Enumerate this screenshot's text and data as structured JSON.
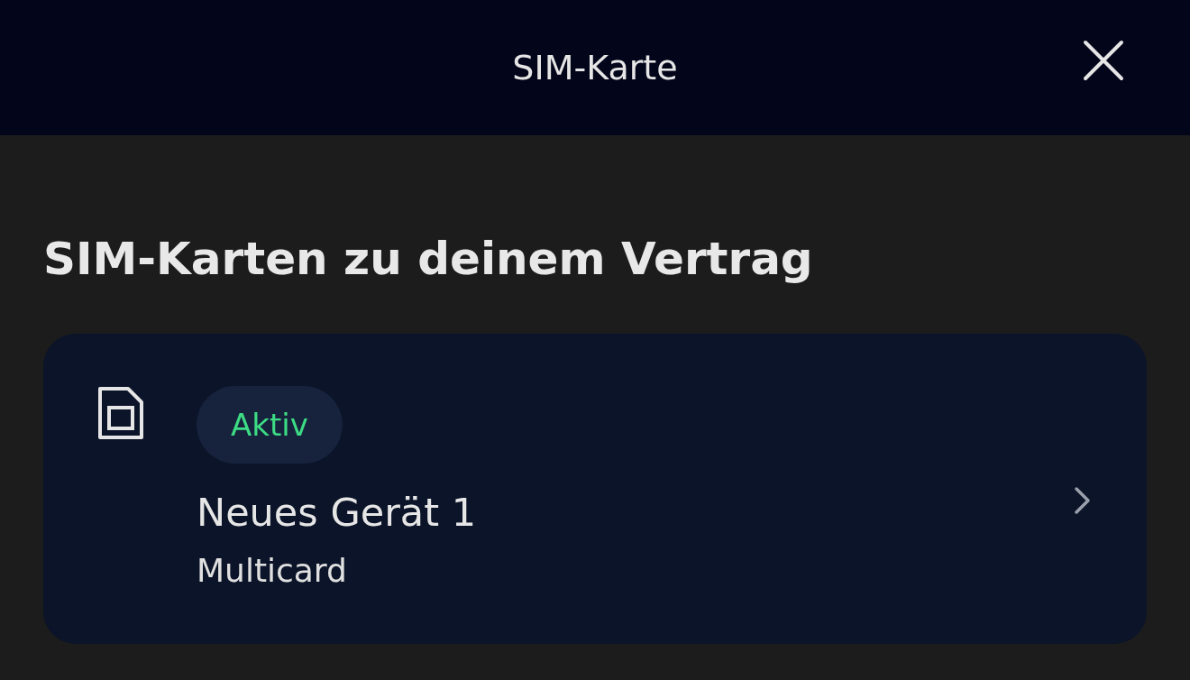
{
  "header": {
    "title": "SIM-Karte"
  },
  "section": {
    "title": "SIM-Karten zu deinem Vertrag"
  },
  "sim_cards": [
    {
      "status": {
        "label": "Aktiv",
        "kind": "active"
      },
      "name": "Neues Gerät 1",
      "type": "Multicard"
    }
  ]
}
